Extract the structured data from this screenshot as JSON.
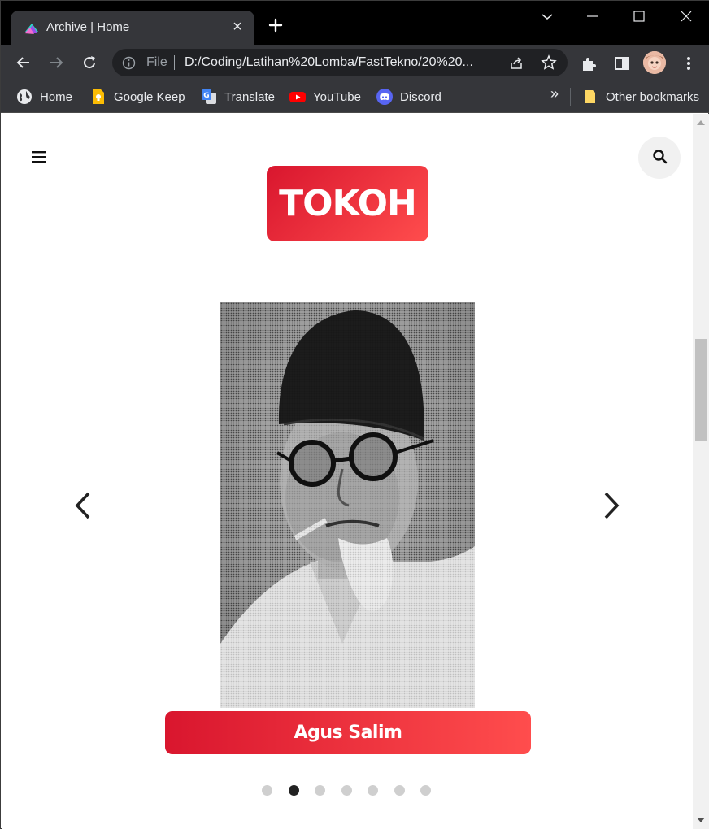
{
  "browser": {
    "tab_title": "Archive | Home",
    "close_glyph": "×",
    "address": {
      "scheme_label": "File",
      "url": "D:/Coding/Latihan%20Lomba/FastTekno/20%20..."
    },
    "bookmarks": [
      {
        "label": "Home",
        "icon": "globe-icon"
      },
      {
        "label": "Google Keep",
        "icon": "google-keep-icon"
      },
      {
        "label": "Translate",
        "icon": "translate-icon"
      },
      {
        "label": "YouTube",
        "icon": "youtube-icon"
      },
      {
        "label": "Discord",
        "icon": "discord-icon"
      }
    ],
    "overflow_glyph": "»",
    "other_bookmarks": "Other bookmarks"
  },
  "page": {
    "heading": "TOKOH",
    "slide": {
      "caption": "Agus Salim",
      "photo_icon": "portrait-photo"
    },
    "carousel": {
      "total_slides": 7,
      "active_index": 1
    },
    "scrollbar": {
      "scroll_fraction": 0.36
    }
  },
  "colors": {
    "accent_start": "#d9162e",
    "accent_end": "#ff4d4d",
    "chrome_bg": "#35363a",
    "tabstrip_bg": "#000000"
  }
}
